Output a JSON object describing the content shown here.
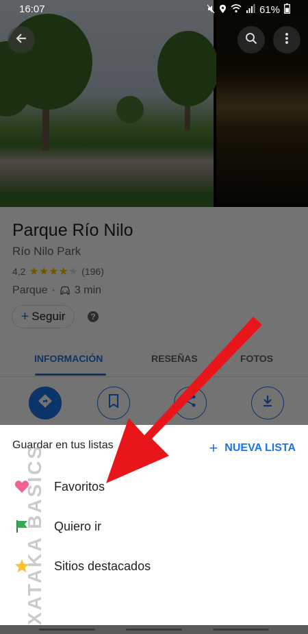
{
  "status_bar": {
    "time": "16:07",
    "battery": "61%"
  },
  "place": {
    "title": "Parque Río Nilo",
    "subtitle": "Río Nilo Park",
    "rating": "4,2",
    "rating_value": 4.2,
    "review_count": "(196)",
    "category": "Parque",
    "drive_time": "3 min",
    "follow_label": "Seguir"
  },
  "tabs": [
    {
      "label": "INFORMACIÓN",
      "active": true
    },
    {
      "label": "RESEÑAS",
      "active": false
    },
    {
      "label": "FOTOS",
      "active": false
    }
  ],
  "save_panel": {
    "title": "Guardar en tus listas",
    "new_list_label": "NUEVA LISTA",
    "lists": [
      {
        "label": "Favoritos",
        "icon": "heart-icon",
        "color": "#f06292"
      },
      {
        "label": "Quiero ir",
        "icon": "flag-icon",
        "color": "#34a853"
      },
      {
        "label": "Sitios destacados",
        "icon": "star-icon",
        "color": "#fbc02d"
      }
    ]
  },
  "watermark": "XATAKA BASICS",
  "colors": {
    "accent": "#1a73e8",
    "arrow": "#e8161b",
    "star": "#fbbc04"
  }
}
